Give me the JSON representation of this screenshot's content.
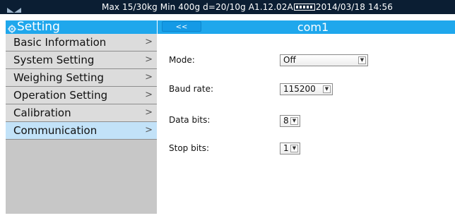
{
  "status_bar": {
    "info_left": "Max 15/30kg  Min 400g  d=20/10g   A1.12.02A",
    "date": "2014/03/18",
    "time": "14:56",
    "logo_icon": "brand-logo-icon",
    "battery_icon": "battery-icon"
  },
  "header": {
    "title": "Setting",
    "settings_icon": "settings-icon",
    "back_label": "<<",
    "page_title": "com1"
  },
  "sidebar": {
    "items": [
      {
        "label": "Basic Information",
        "chevron": ">",
        "active": false
      },
      {
        "label": "System Setting",
        "chevron": ">",
        "active": false
      },
      {
        "label": "Weighing Setting",
        "chevron": ">",
        "active": false
      },
      {
        "label": "Operation Setting",
        "chevron": ">",
        "active": false
      },
      {
        "label": "Calibration",
        "chevron": ">",
        "active": false
      },
      {
        "label": "Communication",
        "chevron": ">",
        "active": true
      }
    ]
  },
  "form": {
    "fields": [
      {
        "label": "Mode:",
        "value": "Off"
      },
      {
        "label": "Baud rate:",
        "value": "115200"
      },
      {
        "label": "Data bits:",
        "value": "8"
      },
      {
        "label": "Stop bits:",
        "value": "1"
      }
    ]
  },
  "colors": {
    "status_bar_bg": "#0b1e33",
    "header_bg": "#1fa7ec",
    "sidebar_bg": "#c7c7c7",
    "menu_item_bg": "#dcdcdc",
    "menu_item_active_bg": "#c2e2f8"
  }
}
